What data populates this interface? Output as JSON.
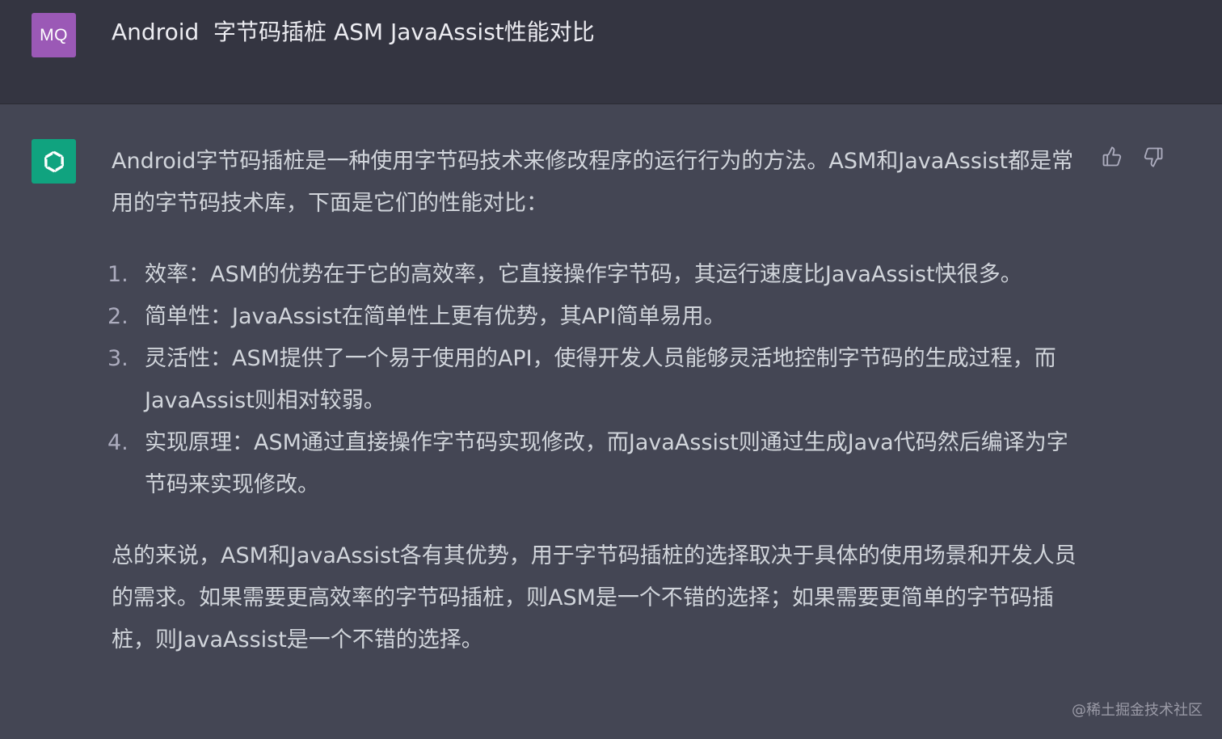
{
  "user_message": {
    "avatar_initials": "MQ",
    "text": "Android  字节码插桩 ASM JavaAssist性能对比"
  },
  "assistant_message": {
    "intro": "Android字节码插桩是一种使用字节码技术来修改程序的运行行为的方法。ASM和JavaAssist都是常用的字节码技术库，下面是它们的性能对比：",
    "list": [
      {
        "num": "1.",
        "text": "效率：ASM的优势在于它的高效率，它直接操作字节码，其运行速度比JavaAssist快很多。"
      },
      {
        "num": "2.",
        "text": "简单性：JavaAssist在简单性上更有优势，其API简单易用。"
      },
      {
        "num": "3.",
        "text": "灵活性：ASM提供了一个易于使用的API，使得开发人员能够灵活地控制字节码的生成过程，而JavaAssist则相对较弱。"
      },
      {
        "num": "4.",
        "text": "实现原理：ASM通过直接操作字节码实现修改，而JavaAssist则通过生成Java代码然后编译为字节码来实现修改。"
      }
    ],
    "conclusion": "总的来说，ASM和JavaAssist各有其优势，用于字节码插桩的选择取决于具体的使用场景和开发人员的需求。如果需要更高效率的字节码插桩，则ASM是一个不错的选择；如果需要更简单的字节码插桩，则JavaAssist是一个不错的选择。"
  },
  "feedback": {
    "thumb_up_icon": "thumbs-up-icon",
    "thumb_down_icon": "thumbs-down-icon"
  },
  "watermark": "@稀土掘金技术社区",
  "colors": {
    "user_bg": "#343541",
    "assistant_bg": "#444654",
    "user_avatar": "#9b59b6",
    "bot_avatar": "#10a37f"
  }
}
